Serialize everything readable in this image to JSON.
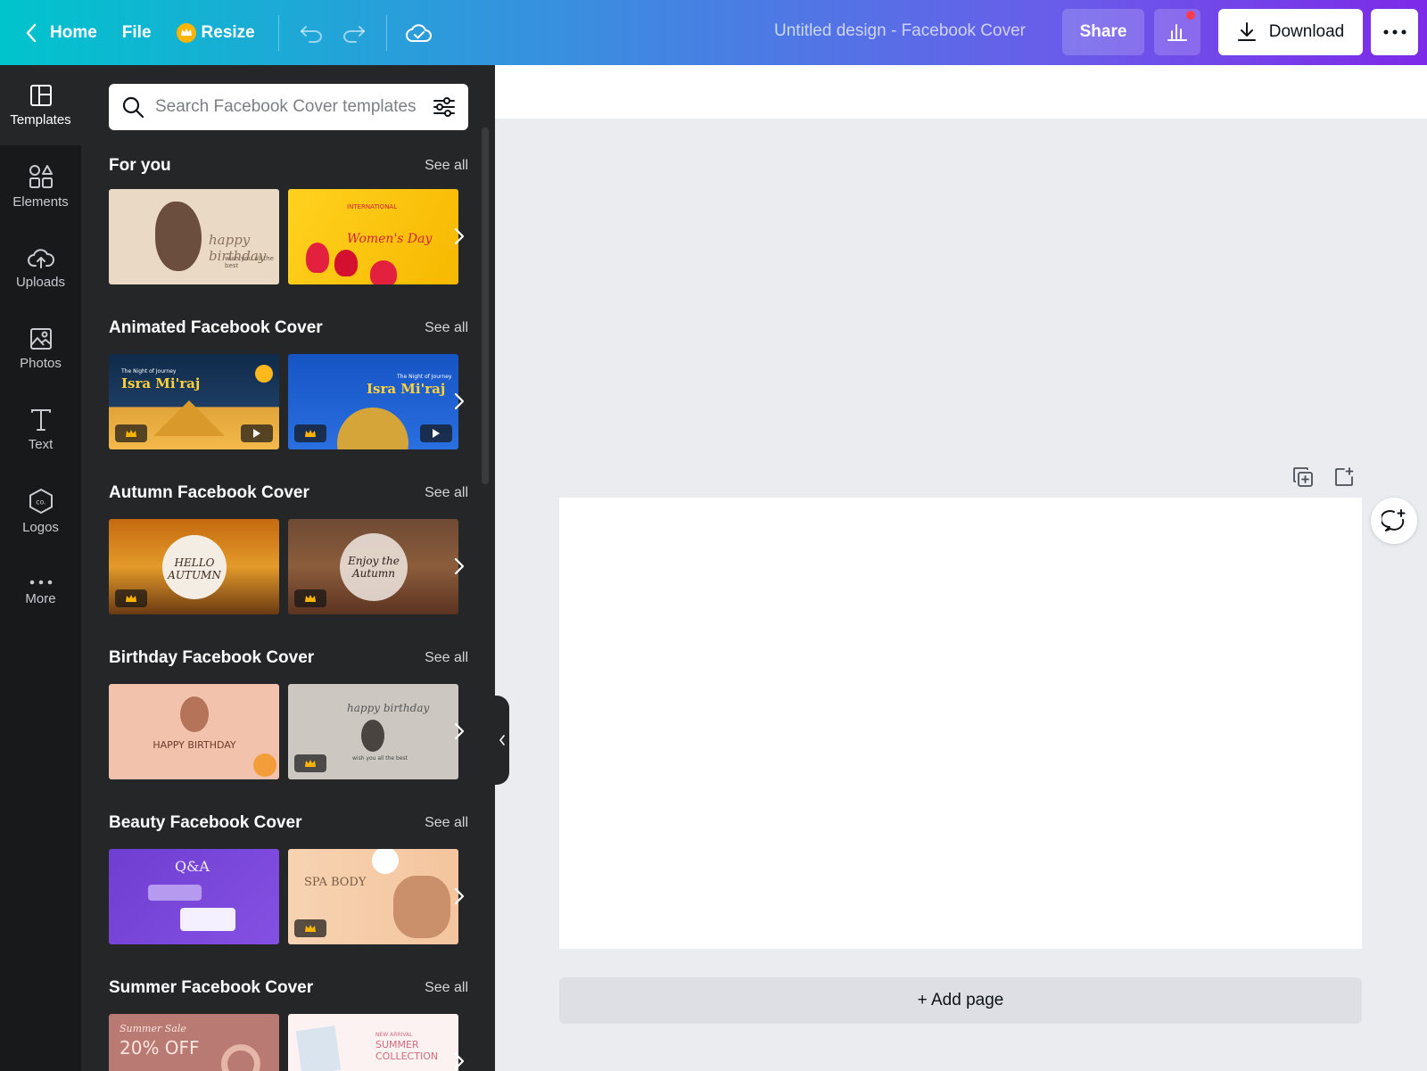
{
  "topbar": {
    "home_label": "Home",
    "file_label": "File",
    "resize_label": "Resize",
    "design_title": "Untitled design - Facebook Cover",
    "share_label": "Share",
    "download_label": "Download"
  },
  "rail": {
    "items": [
      {
        "label": "Templates",
        "icon": "templates-icon"
      },
      {
        "label": "Elements",
        "icon": "elements-icon"
      },
      {
        "label": "Uploads",
        "icon": "uploads-icon"
      },
      {
        "label": "Photos",
        "icon": "photos-icon"
      },
      {
        "label": "Text",
        "icon": "text-icon"
      },
      {
        "label": "Logos",
        "icon": "logos-icon"
      },
      {
        "label": "More",
        "icon": "more-icon"
      }
    ]
  },
  "search": {
    "placeholder": "Search Facebook Cover templates"
  },
  "see_all": "See all",
  "sections": [
    {
      "title": "For you",
      "thumbs": [
        {
          "text": "happy birthday",
          "sub": "wish you all the best"
        },
        {
          "text": "Women's Day",
          "sub": "INTERNATIONAL"
        }
      ]
    },
    {
      "title": "Animated Facebook Cover",
      "thumbs": [
        {
          "text": "Isra Mi'raj",
          "sub": "The Night of Journey"
        },
        {
          "text": "Isra Mi'raj",
          "sub": "The Night of Journey"
        }
      ]
    },
    {
      "title": "Autumn Facebook Cover",
      "thumbs": [
        {
          "text": "HELLO AUTUMN"
        },
        {
          "text": "Enjoy the Autumn"
        }
      ]
    },
    {
      "title": "Birthday Facebook Cover",
      "thumbs": [
        {
          "text": "HAPPY BIRTHDAY"
        },
        {
          "text": "happy birthday",
          "sub": "wish you all the best"
        }
      ]
    },
    {
      "title": "Beauty Facebook Cover",
      "thumbs": [
        {
          "text": "Q&A"
        },
        {
          "text": "SPA BODY"
        }
      ]
    },
    {
      "title": "Summer Facebook Cover",
      "thumbs": [
        {
          "text": "20% OFF",
          "sub": "Summer Sale"
        },
        {
          "text": "SUMMER COLLECTION",
          "sub": "NEW ARRIVAL"
        }
      ]
    }
  ],
  "canvas": {
    "add_page_label": "+ Add page"
  },
  "colors": {
    "accent": "#7d2ae8",
    "brand_teal": "#00c4cc",
    "panel": "#252627",
    "rail": "#18191b"
  }
}
